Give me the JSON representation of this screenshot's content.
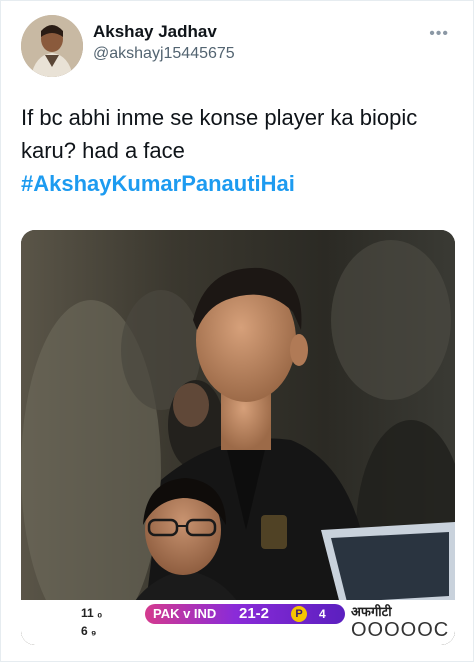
{
  "tweet": {
    "display_name": "Akshay Jadhav",
    "handle": "@akshayj15445675",
    "more_icon": "•••",
    "text": "If bc abhi inme se konse player ka biopic karu? had a face",
    "hashtag": "#AkshayKumarPanautiHai"
  },
  "scoreboard": {
    "left_top": "11 ₀",
    "left_bottom": "6 ₉",
    "teams": "PAK v IND",
    "score": "21-2",
    "badge": "P",
    "overs": "4",
    "marathi_label": "अफगीटी",
    "balls": "OOOOOC"
  },
  "colors": {
    "hashtag": "#1d9bf0",
    "text": "#0f1419",
    "muted": "#536471"
  }
}
